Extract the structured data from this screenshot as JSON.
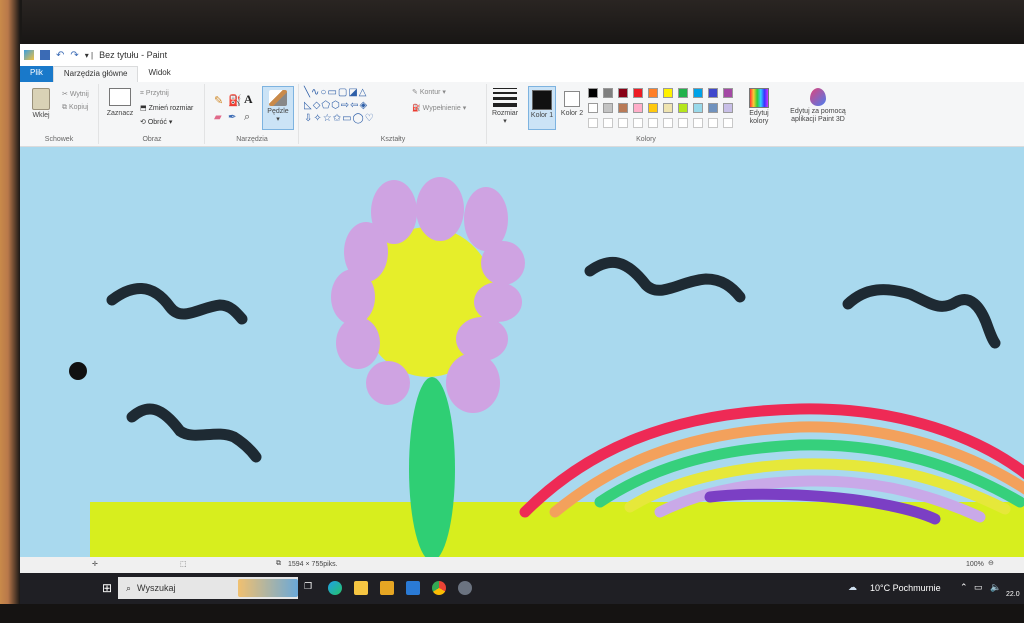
{
  "window": {
    "title": "Bez tytułu - Paint"
  },
  "tabs": {
    "file": "Plik",
    "home": "Narzędzia główne",
    "view": "Widok"
  },
  "clipboard": {
    "paste": "Wklej",
    "cut": "Wytnij",
    "copy": "Kopiuj",
    "group": "Schowek"
  },
  "image": {
    "select": "Zaznacz",
    "crop": "Przytnij",
    "resize": "Zmień rozmiar",
    "rotate": "Obróć",
    "group": "Obraz"
  },
  "tools": {
    "brushes": "Pędzle",
    "group": "Narzędzia"
  },
  "shapes": {
    "outline": "Kontur",
    "fill": "Wypełnienie",
    "group": "Kształty"
  },
  "size": {
    "label": "Rozmiar"
  },
  "colors": {
    "color1": "Kolor 1",
    "color2": "Kolor 2",
    "edit": "Edytuj kolory",
    "paint3d": "Edytuj za pomocą aplikacji Paint 3D",
    "group": "Kolory",
    "palette_row1": [
      "#000000",
      "#7f7f7f",
      "#880015",
      "#ed1c24",
      "#ff7f27",
      "#fff200",
      "#22b14c",
      "#00a2e8",
      "#3f48cc",
      "#a349a4"
    ],
    "palette_row2": [
      "#ffffff",
      "#c3c3c3",
      "#b97a57",
      "#ffaec9",
      "#ffc90e",
      "#efe4b0",
      "#b5e61d",
      "#99d9ea",
      "#7092be",
      "#c8bfe7"
    ]
  },
  "statusbar": {
    "dimensions": "1594 × 755piks.",
    "zoom": "100%"
  },
  "taskbar": {
    "search": "Wyszukaj",
    "weather": "10°C Pochmurnie",
    "date": "22.0"
  },
  "drawing": {
    "sky": "#a9d9ee",
    "ground": "#d7ee1e",
    "petal": "#cfa3e2",
    "flower_center": "#e6ee2a",
    "stem": "#2fcf74",
    "bird": "#1e2a33",
    "rainbow": [
      "#ee2a55",
      "#f3a15c",
      "#36d07c",
      "#e6e83a",
      "#c9a9e8",
      "#7b3fc4"
    ]
  }
}
